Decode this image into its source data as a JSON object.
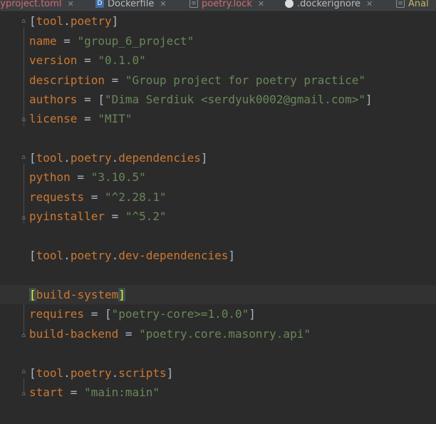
{
  "tabs": [
    {
      "label": "pyproject.toml",
      "icon": "toml-file-icon",
      "active": true
    },
    {
      "label": "Dockerfile",
      "icon": "docker-file-icon",
      "active": false
    },
    {
      "label": "poetry.lock",
      "icon": "lock-file-icon",
      "active": false
    },
    {
      "label": ".dockerignore",
      "icon": "ignore-file-icon",
      "active": false
    },
    {
      "label": "Anal",
      "icon": "python-file-icon",
      "active": false
    }
  ],
  "close_glyph": "✕",
  "colors": {
    "background": "#2b2b2b",
    "keyword": "#cc7832",
    "string": "#6a8759",
    "text": "#a9b7c6",
    "current_line": "#323232",
    "bracket_match": "#ffef28"
  },
  "code": {
    "poetry_header": {
      "open": "[",
      "parts": [
        "tool",
        ".",
        "poetry"
      ],
      "close": "]"
    },
    "name": {
      "key": "name",
      "eq": " = ",
      "value": "\"group_6_project\""
    },
    "version": {
      "key": "version",
      "eq": " = ",
      "value": "\"0.1.0\""
    },
    "description": {
      "key": "description",
      "eq": " = ",
      "value": "\"Group project for poetry practice\""
    },
    "authors": {
      "key": "authors",
      "eq": " = ",
      "open": "[",
      "value": "\"Dima Serdiuk <serdyuk0002@gmail.com>\"",
      "close": "]"
    },
    "license": {
      "key": "license",
      "eq": " = ",
      "value": "\"MIT\""
    },
    "deps_header": {
      "open": "[",
      "parts": [
        "tool",
        ".",
        "poetry",
        ".",
        "dependencies"
      ],
      "close": "]"
    },
    "python": {
      "key": "python",
      "eq": " = ",
      "value": "\"3.10.5\""
    },
    "requests": {
      "key": "requests",
      "eq": " = ",
      "value": "\"^2.28.1\""
    },
    "pyinstaller": {
      "key": "pyinstaller",
      "eq": " = ",
      "value": "\"^5.2\""
    },
    "devdeps_header": {
      "open": "[",
      "parts": [
        "tool",
        ".",
        "poetry",
        ".",
        "dev-dependencies"
      ],
      "close": "]"
    },
    "build_header": {
      "open": "[",
      "parts": [
        "build-system"
      ],
      "close": "]"
    },
    "requires": {
      "key": "requires",
      "eq": " = ",
      "open": "[",
      "value": "\"poetry-core>=1.0.0\"",
      "close": "]"
    },
    "build_backend": {
      "key": "build-backend",
      "eq": " = ",
      "value": "\"poetry.core.masonry.api\""
    },
    "scripts_header": {
      "open": "[",
      "parts": [
        "tool",
        ".",
        "poetry",
        ".",
        "scripts"
      ],
      "close": "]"
    },
    "start": {
      "key": "start",
      "eq": " = ",
      "value": "\"main:main\""
    }
  }
}
